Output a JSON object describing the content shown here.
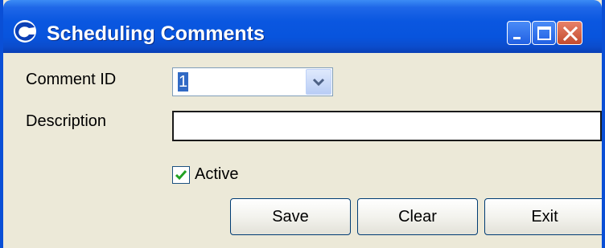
{
  "window": {
    "title": "Scheduling Comments",
    "controls": [
      "minimize-icon",
      "maximize-icon",
      "close-icon"
    ],
    "accent_color": "#0a57e0",
    "background_color": "#ece9d8"
  },
  "form": {
    "comment_id_label": "Comment ID",
    "comment_id_value": "1",
    "description_label": "Description",
    "description_value": "",
    "active_label": "Active",
    "active_checked": true
  },
  "buttons": {
    "save": "Save",
    "clear": "Clear",
    "exit": "Exit"
  }
}
